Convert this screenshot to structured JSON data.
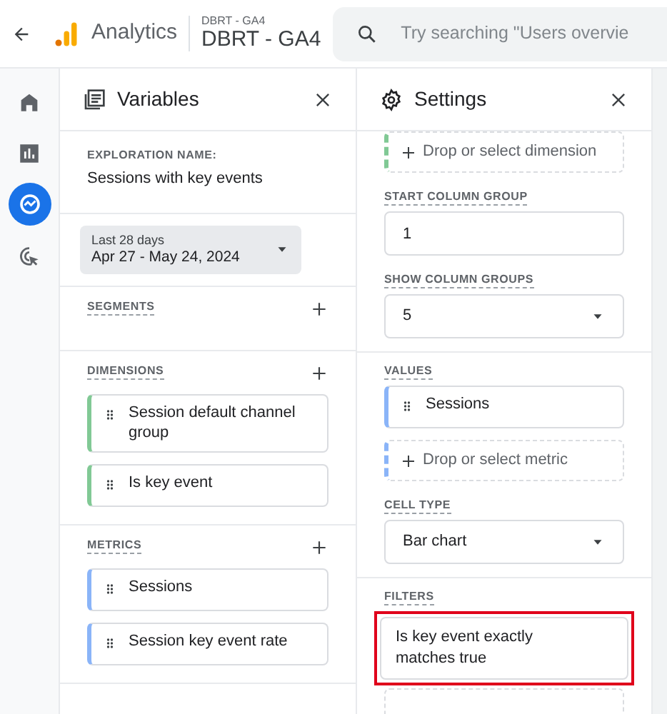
{
  "header": {
    "app_name": "Analytics",
    "account": "DBRT - GA4",
    "property": "DBRT - GA4",
    "search": {
      "placeholder": "Try searching \"Users overvie"
    }
  },
  "nav_rail": [
    {
      "kind": "home",
      "selected": false
    },
    {
      "kind": "reports",
      "selected": false
    },
    {
      "kind": "explore",
      "selected": true
    },
    {
      "kind": "advertising",
      "selected": false
    }
  ],
  "variables_panel": {
    "title": "Variables",
    "exploration_name": {
      "label": "EXPLORATION NAME:",
      "value": "Sessions with key events"
    },
    "date_range": {
      "label": "Last 28 days",
      "value": "Apr 27 - May 24, 2024"
    },
    "sections": [
      {
        "label": "SEGMENTS"
      },
      {
        "label": "DIMENSIONS",
        "items": [
          {
            "kind": "dimension",
            "text": "Session default channel group"
          },
          {
            "kind": "dimension",
            "text": "Is key event"
          }
        ]
      },
      {
        "label": "METRICS",
        "items": [
          {
            "kind": "metric",
            "text": "Sessions"
          },
          {
            "kind": "metric",
            "text": "Session key event rate"
          }
        ]
      }
    ]
  },
  "settings_panel": {
    "title": "Settings",
    "sections": [
      [
        {
          "kind": "dimension_dropzone",
          "text": "Drop or select dimension"
        },
        {
          "kind": "label",
          "text": "START COLUMN GROUP"
        },
        {
          "kind": "input",
          "value": "1"
        },
        {
          "kind": "label",
          "text": "SHOW COLUMN GROUPS"
        },
        {
          "kind": "select",
          "value": "5"
        }
      ],
      [
        {
          "kind": "label",
          "text": "VALUES"
        },
        {
          "kind": "metric_chip",
          "text": "Sessions"
        },
        {
          "kind": "metric_dropzone",
          "text": "Drop or select metric"
        },
        {
          "kind": "label",
          "text": "CELL TYPE"
        },
        {
          "kind": "select",
          "value": "Bar chart"
        }
      ],
      [
        {
          "kind": "label",
          "text": "FILTERS"
        },
        {
          "kind": "filter",
          "text": "Is key event exactly matches true",
          "highlighted": true
        },
        {
          "kind": "empty_dropzone"
        }
      ]
    ]
  }
}
